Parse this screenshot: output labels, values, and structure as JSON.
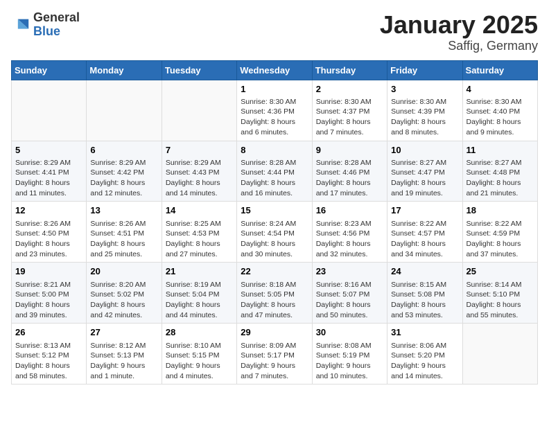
{
  "logo": {
    "general": "General",
    "blue": "Blue"
  },
  "title": "January 2025",
  "subtitle": "Saffig, Germany",
  "days_of_week": [
    "Sunday",
    "Monday",
    "Tuesday",
    "Wednesday",
    "Thursday",
    "Friday",
    "Saturday"
  ],
  "weeks": [
    [
      {
        "day": "",
        "info": ""
      },
      {
        "day": "",
        "info": ""
      },
      {
        "day": "",
        "info": ""
      },
      {
        "day": "1",
        "info": "Sunrise: 8:30 AM\nSunset: 4:36 PM\nDaylight: 8 hours\nand 6 minutes."
      },
      {
        "day": "2",
        "info": "Sunrise: 8:30 AM\nSunset: 4:37 PM\nDaylight: 8 hours\nand 7 minutes."
      },
      {
        "day": "3",
        "info": "Sunrise: 8:30 AM\nSunset: 4:39 PM\nDaylight: 8 hours\nand 8 minutes."
      },
      {
        "day": "4",
        "info": "Sunrise: 8:30 AM\nSunset: 4:40 PM\nDaylight: 8 hours\nand 9 minutes."
      }
    ],
    [
      {
        "day": "5",
        "info": "Sunrise: 8:29 AM\nSunset: 4:41 PM\nDaylight: 8 hours\nand 11 minutes."
      },
      {
        "day": "6",
        "info": "Sunrise: 8:29 AM\nSunset: 4:42 PM\nDaylight: 8 hours\nand 12 minutes."
      },
      {
        "day": "7",
        "info": "Sunrise: 8:29 AM\nSunset: 4:43 PM\nDaylight: 8 hours\nand 14 minutes."
      },
      {
        "day": "8",
        "info": "Sunrise: 8:28 AM\nSunset: 4:44 PM\nDaylight: 8 hours\nand 16 minutes."
      },
      {
        "day": "9",
        "info": "Sunrise: 8:28 AM\nSunset: 4:46 PM\nDaylight: 8 hours\nand 17 minutes."
      },
      {
        "day": "10",
        "info": "Sunrise: 8:27 AM\nSunset: 4:47 PM\nDaylight: 8 hours\nand 19 minutes."
      },
      {
        "day": "11",
        "info": "Sunrise: 8:27 AM\nSunset: 4:48 PM\nDaylight: 8 hours\nand 21 minutes."
      }
    ],
    [
      {
        "day": "12",
        "info": "Sunrise: 8:26 AM\nSunset: 4:50 PM\nDaylight: 8 hours\nand 23 minutes."
      },
      {
        "day": "13",
        "info": "Sunrise: 8:26 AM\nSunset: 4:51 PM\nDaylight: 8 hours\nand 25 minutes."
      },
      {
        "day": "14",
        "info": "Sunrise: 8:25 AM\nSunset: 4:53 PM\nDaylight: 8 hours\nand 27 minutes."
      },
      {
        "day": "15",
        "info": "Sunrise: 8:24 AM\nSunset: 4:54 PM\nDaylight: 8 hours\nand 30 minutes."
      },
      {
        "day": "16",
        "info": "Sunrise: 8:23 AM\nSunset: 4:56 PM\nDaylight: 8 hours\nand 32 minutes."
      },
      {
        "day": "17",
        "info": "Sunrise: 8:22 AM\nSunset: 4:57 PM\nDaylight: 8 hours\nand 34 minutes."
      },
      {
        "day": "18",
        "info": "Sunrise: 8:22 AM\nSunset: 4:59 PM\nDaylight: 8 hours\nand 37 minutes."
      }
    ],
    [
      {
        "day": "19",
        "info": "Sunrise: 8:21 AM\nSunset: 5:00 PM\nDaylight: 8 hours\nand 39 minutes."
      },
      {
        "day": "20",
        "info": "Sunrise: 8:20 AM\nSunset: 5:02 PM\nDaylight: 8 hours\nand 42 minutes."
      },
      {
        "day": "21",
        "info": "Sunrise: 8:19 AM\nSunset: 5:04 PM\nDaylight: 8 hours\nand 44 minutes."
      },
      {
        "day": "22",
        "info": "Sunrise: 8:18 AM\nSunset: 5:05 PM\nDaylight: 8 hours\nand 47 minutes."
      },
      {
        "day": "23",
        "info": "Sunrise: 8:16 AM\nSunset: 5:07 PM\nDaylight: 8 hours\nand 50 minutes."
      },
      {
        "day": "24",
        "info": "Sunrise: 8:15 AM\nSunset: 5:08 PM\nDaylight: 8 hours\nand 53 minutes."
      },
      {
        "day": "25",
        "info": "Sunrise: 8:14 AM\nSunset: 5:10 PM\nDaylight: 8 hours\nand 55 minutes."
      }
    ],
    [
      {
        "day": "26",
        "info": "Sunrise: 8:13 AM\nSunset: 5:12 PM\nDaylight: 8 hours\nand 58 minutes."
      },
      {
        "day": "27",
        "info": "Sunrise: 8:12 AM\nSunset: 5:13 PM\nDaylight: 9 hours\nand 1 minute."
      },
      {
        "day": "28",
        "info": "Sunrise: 8:10 AM\nSunset: 5:15 PM\nDaylight: 9 hours\nand 4 minutes."
      },
      {
        "day": "29",
        "info": "Sunrise: 8:09 AM\nSunset: 5:17 PM\nDaylight: 9 hours\nand 7 minutes."
      },
      {
        "day": "30",
        "info": "Sunrise: 8:08 AM\nSunset: 5:19 PM\nDaylight: 9 hours\nand 10 minutes."
      },
      {
        "day": "31",
        "info": "Sunrise: 8:06 AM\nSunset: 5:20 PM\nDaylight: 9 hours\nand 14 minutes."
      },
      {
        "day": "",
        "info": ""
      }
    ]
  ]
}
